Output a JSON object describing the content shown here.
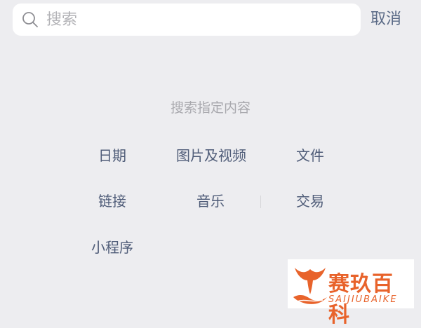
{
  "search": {
    "placeholder": "搜索",
    "value": ""
  },
  "cancel_label": "取消",
  "section_title": "搜索指定内容",
  "options": {
    "date": "日期",
    "media": "图片及视频",
    "file": "文件",
    "link": "链接",
    "music": "音乐",
    "trade": "交易",
    "mini_program": "小程序"
  },
  "watermark": {
    "title": "赛玖百科",
    "subtitle": "SAIJIUBAIKE",
    "color": "#e8632b"
  },
  "colors": {
    "background": "#ededf0",
    "option_text": "#4f5c78",
    "muted_text": "#a9a9ae",
    "cancel_text": "#5a6a86"
  }
}
